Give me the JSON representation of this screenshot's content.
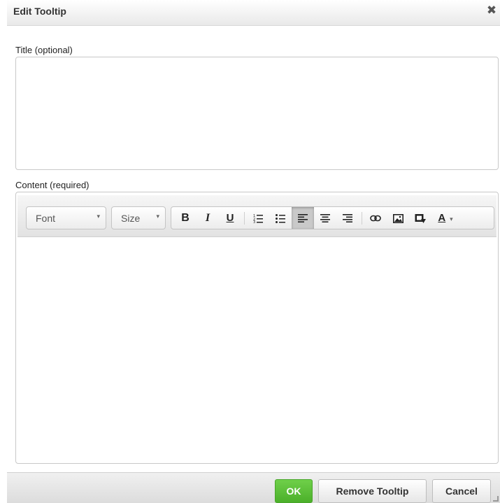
{
  "dialog": {
    "title": "Edit Tooltip",
    "close_glyph": "✖"
  },
  "fields": {
    "title_label": "Title (optional)",
    "title_value": "",
    "content_label": "Content (required)",
    "content_value": ""
  },
  "toolbar": {
    "font_label": "Font",
    "size_label": "Size",
    "dropdown_glyph": "▾",
    "buttons": [
      {
        "name": "bold",
        "icon": "bold-icon",
        "active": false
      },
      {
        "name": "italic",
        "icon": "italic-icon",
        "active": false
      },
      {
        "name": "underline",
        "icon": "underline-icon",
        "active": false
      },
      {
        "name": "numbered-list",
        "icon": "numbered-list-icon",
        "active": false
      },
      {
        "name": "bulleted-list",
        "icon": "bulleted-list-icon",
        "active": false
      },
      {
        "name": "align-left",
        "icon": "align-left-icon",
        "active": true
      },
      {
        "name": "align-center",
        "icon": "align-center-icon",
        "active": false
      },
      {
        "name": "align-right",
        "icon": "align-right-icon",
        "active": false
      },
      {
        "name": "link",
        "icon": "link-icon",
        "active": false
      },
      {
        "name": "image",
        "icon": "image-icon",
        "active": false
      },
      {
        "name": "media",
        "icon": "media-icon",
        "active": false
      },
      {
        "name": "text-color",
        "icon": "text-color-icon",
        "active": false
      }
    ],
    "bold_glyph": "B",
    "italic_glyph": "I",
    "underline_glyph": "U",
    "text_color_glyph": "A"
  },
  "footer": {
    "ok_label": "OK",
    "remove_label": "Remove Tooltip",
    "cancel_label": "Cancel"
  },
  "colors": {
    "ok_green": "#5cc03a",
    "active_button": "#c9c9c9"
  }
}
